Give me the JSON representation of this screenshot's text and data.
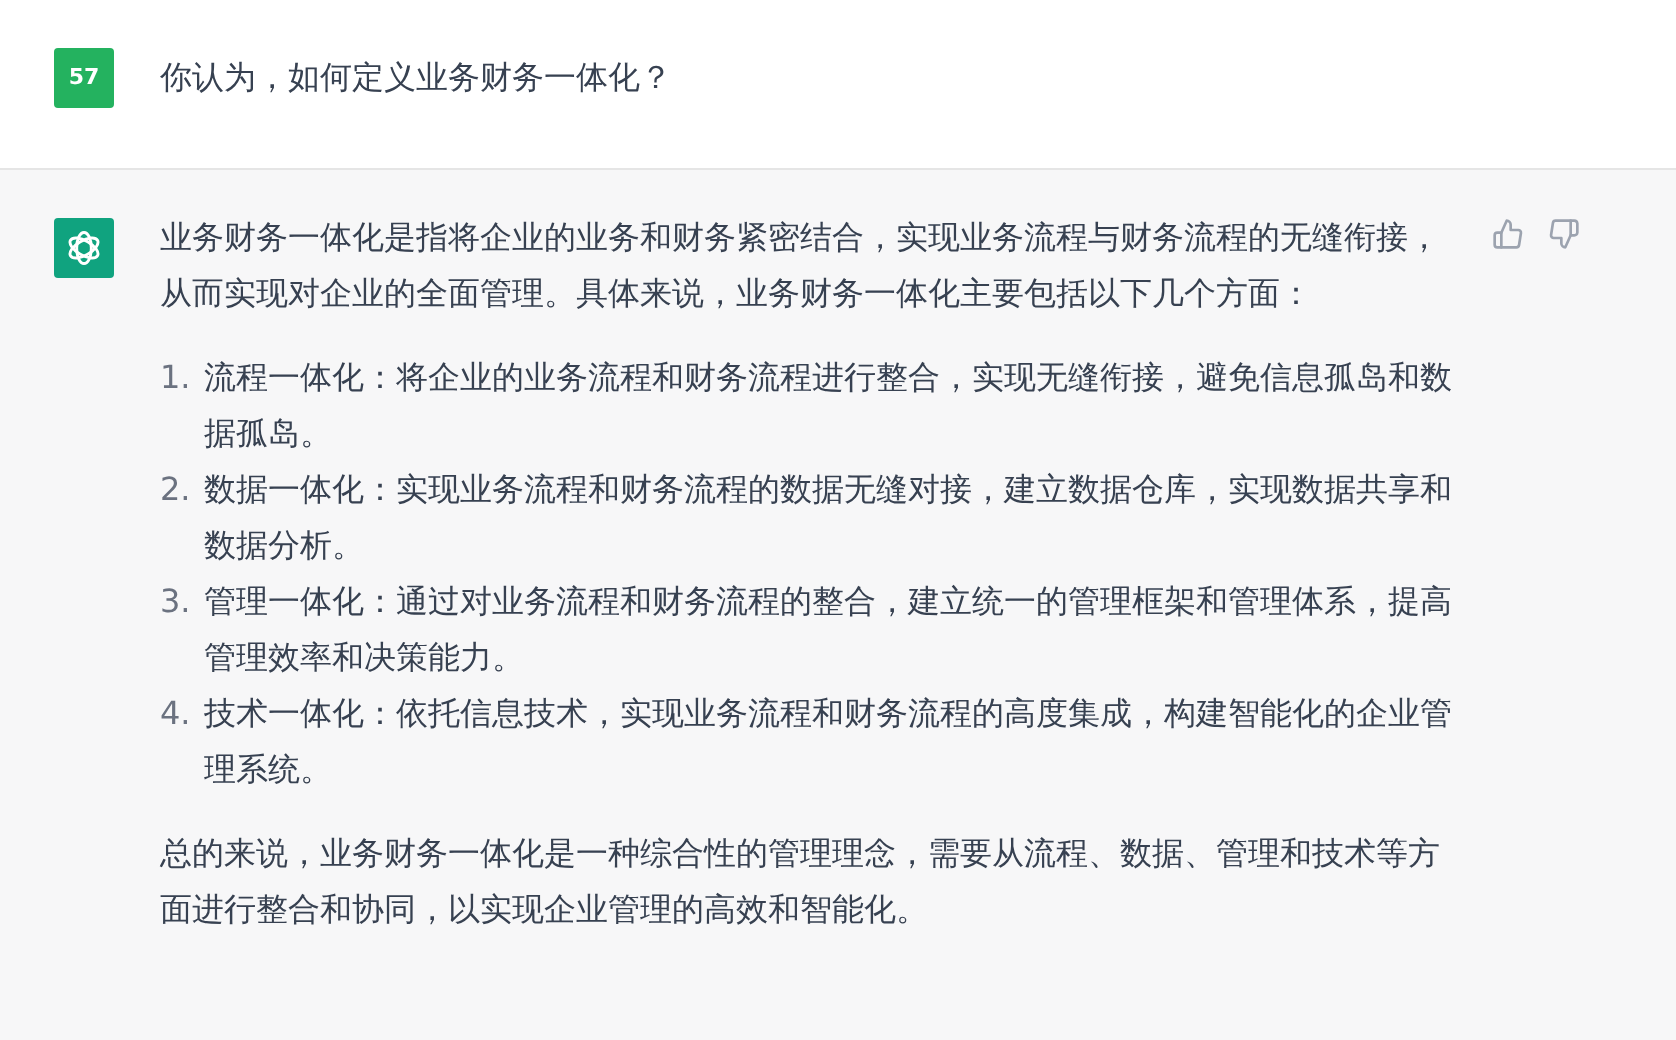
{
  "user_message": {
    "avatar": "57",
    "text": "你认为，如何定义业务财务一体化？"
  },
  "assistant_message": {
    "intro": "业务财务一体化是指将企业的业务和财务紧密结合，实现业务流程与财务流程的无缝衔接，从而实现对企业的全面管理。具体来说，业务财务一体化主要包括以下几个方面：",
    "items": [
      {
        "number": "1.",
        "text": "流程一体化：将企业的业务流程和财务流程进行整合，实现无缝衔接，避免信息孤岛和数据孤岛。"
      },
      {
        "number": "2.",
        "text": "数据一体化：实现业务流程和财务流程的数据无缝对接，建立数据仓库，实现数据共享和数据分析。"
      },
      {
        "number": "3.",
        "text": "管理一体化：通过对业务流程和财务流程的整合，建立统一的管理框架和管理体系，提高管理效率和决策能力。"
      },
      {
        "number": "4.",
        "text": "技术一体化：依托信息技术，实现业务流程和财务流程的高度集成，构建智能化的企业管理系统。"
      }
    ],
    "conclusion": "总的来说，业务财务一体化是一种综合性的管理理念，需要从流程、数据、管理和技术等方面进行整合和协同，以实现企业管理的高效和智能化。"
  }
}
